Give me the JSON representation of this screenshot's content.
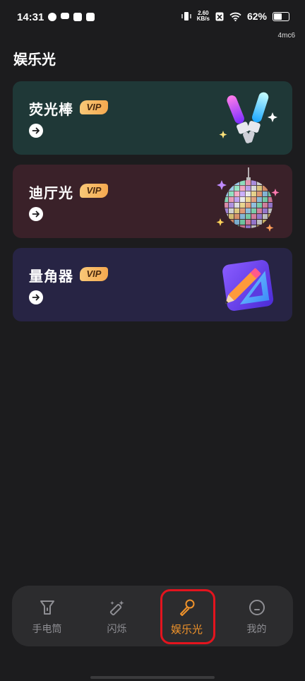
{
  "status_bar": {
    "time": "14:31",
    "speed_value": "2.60",
    "speed_unit": "KB/s",
    "battery": "62%",
    "battery_level": 0.62
  },
  "device_tag": "4mc6",
  "page_title": "娱乐光",
  "cards": [
    {
      "title": "荧光棒",
      "vip": "VIP",
      "art_icon": "glow-sticks-icon",
      "bg": "#1f3837"
    },
    {
      "title": "迪厅光",
      "vip": "VIP",
      "art_icon": "disco-ball-icon",
      "bg": "#3a2129"
    },
    {
      "title": "量角器",
      "vip": "VIP",
      "art_icon": "protractor-pencil-icon",
      "bg": "#272444"
    }
  ],
  "tabs": [
    {
      "label": "手电筒",
      "icon": "flashlight-icon",
      "active": false
    },
    {
      "label": "闪烁",
      "icon": "magic-wand-icon",
      "active": false
    },
    {
      "label": "娱乐光",
      "icon": "microphone-icon",
      "active": true
    },
    {
      "label": "我的",
      "icon": "profile-icon",
      "active": false
    }
  ],
  "colors": {
    "accent": "#f0932b",
    "background": "#1c1c1e",
    "annotation_box": "#e3141e"
  }
}
